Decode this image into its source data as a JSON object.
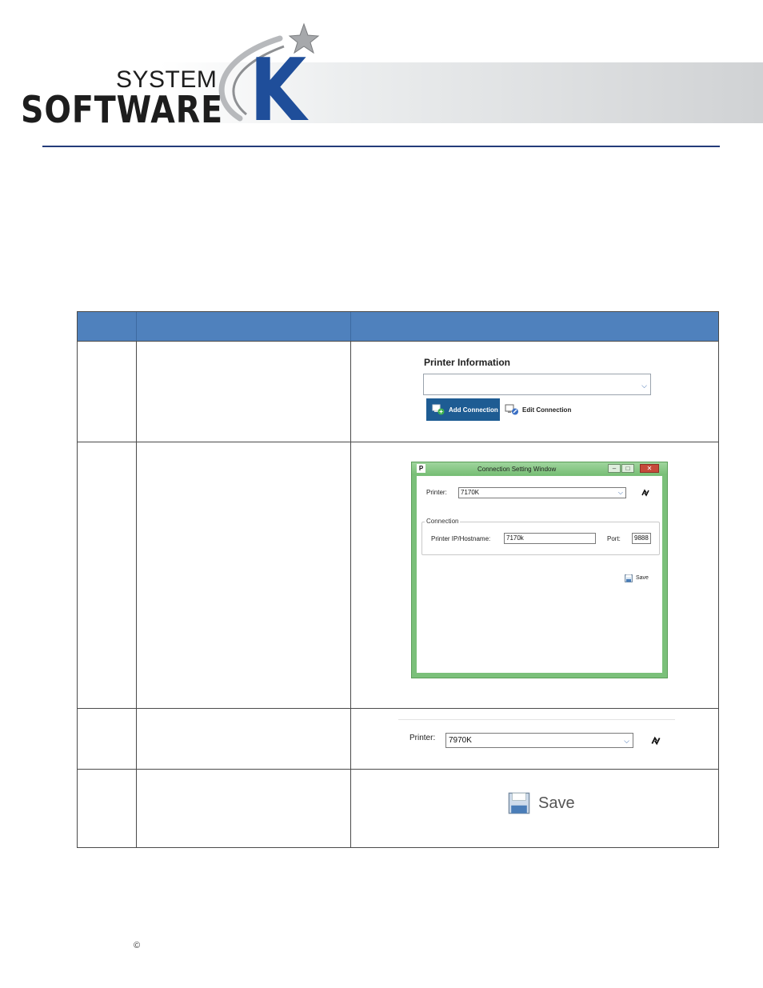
{
  "logo": {
    "line1": "SYSTEM",
    "line2": "SOFTWARE",
    "mark": "K"
  },
  "table": {
    "headers": [
      "",
      "",
      ""
    ],
    "rows": [
      {
        "panel": "printer_information",
        "title": "Printer Information",
        "add_label": "Add Connection",
        "edit_label": "Edit Connection"
      },
      {
        "panel": "connection_window",
        "window_title": "Connection Setting Window",
        "app_icon": "P",
        "printer_label": "Printer:",
        "printer_value": "7170K",
        "group_label": "Connection",
        "ip_label": "Printer IP/Hostname:",
        "ip_value": "7170k",
        "port_label": "Port:",
        "port_value": "9888",
        "save_label": "Save"
      },
      {
        "panel": "printer_select",
        "printer_label": "Printer:",
        "printer_value": "7970K"
      },
      {
        "panel": "save_button",
        "save_label": "Save"
      }
    ]
  },
  "footer": {
    "copyright": "©"
  },
  "colors": {
    "header_fill": "#4f81bd",
    "rule": "#243b7a",
    "logo_blue": "#1f4e9a",
    "add_button": "#1e5c93"
  },
  "icons": [
    "swoosh-star-icon",
    "add-connection-icon",
    "edit-connection-icon",
    "refresh-icon",
    "save-disk-icon",
    "chevron-down-icon"
  ]
}
